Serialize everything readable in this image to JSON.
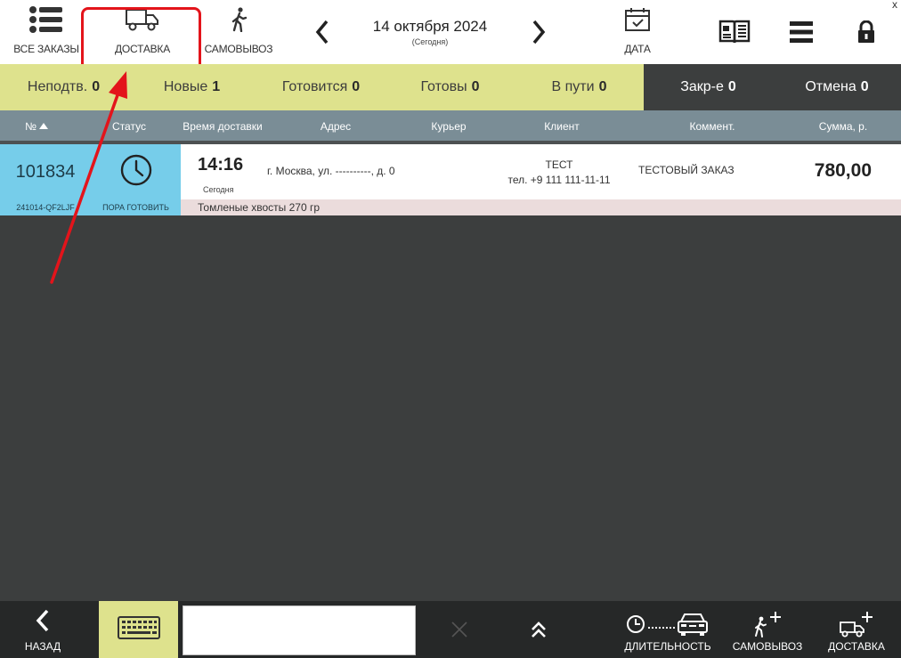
{
  "topbar": {
    "all_orders_label": "ВСЕ ЗАКАЗЫ",
    "delivery_label": "ДОСТАВКА",
    "pickup_label": "САМОВЫВОЗ",
    "date_main": "14 октября 2024",
    "date_sub": "(Сегодня)",
    "date_label": "ДАТА",
    "close_char": "x"
  },
  "filters": [
    {
      "label": "Неподтв.",
      "count": "0"
    },
    {
      "label": "Новые",
      "count": "1"
    },
    {
      "label": "Готовится",
      "count": "0"
    },
    {
      "label": "Готовы",
      "count": "0"
    },
    {
      "label": "В пути",
      "count": "0"
    },
    {
      "label": "Закр-е",
      "count": "0"
    },
    {
      "label": "Отмена",
      "count": "0"
    }
  ],
  "columns": {
    "num": "№",
    "status": "Статус",
    "time": "Время доставки",
    "address": "Адрес",
    "courier": "Курьер",
    "client": "Клиент",
    "comment": "Коммент.",
    "sum": "Сумма, р."
  },
  "order": {
    "number": "101834",
    "code": "241014-QF2LJF",
    "status_label": "ПОРА ГОТОВИТЬ",
    "time": "14:16",
    "time_sub": "Сегодня",
    "address": "г. Москва, ул. ----------, д. 0",
    "client_name": "ТЕСТ",
    "client_phone": "тел. +9 111 111-11-11",
    "comment": "ТЕСТОВЫЙ ЗАКАЗ",
    "sum": "780,00",
    "items": "Томленые хвосты 270 гр"
  },
  "bottombar": {
    "back_label": "НАЗАД",
    "search_value": "",
    "duration_label": "ДЛИТЕЛЬНОСТЬ",
    "pickup_label": "САМОВЫВОЗ",
    "delivery_label": "ДОСТАВКА"
  },
  "colors": {
    "accent_light": "#dee28d",
    "status_blue": "#76cdea",
    "header_gray": "#7a8d96",
    "annotation_red": "#e3141b"
  },
  "icons": [
    "list-icon",
    "truck-icon",
    "walker-icon",
    "chevron-left-icon",
    "chevron-right-icon",
    "calendar-icon",
    "book-icon",
    "hamburger-icon",
    "lock-icon",
    "clock-icon",
    "keyboard-icon",
    "close-icon",
    "double-chevron-up-icon",
    "clock-car-icon",
    "walker-plus-icon",
    "truck-plus-icon"
  ]
}
